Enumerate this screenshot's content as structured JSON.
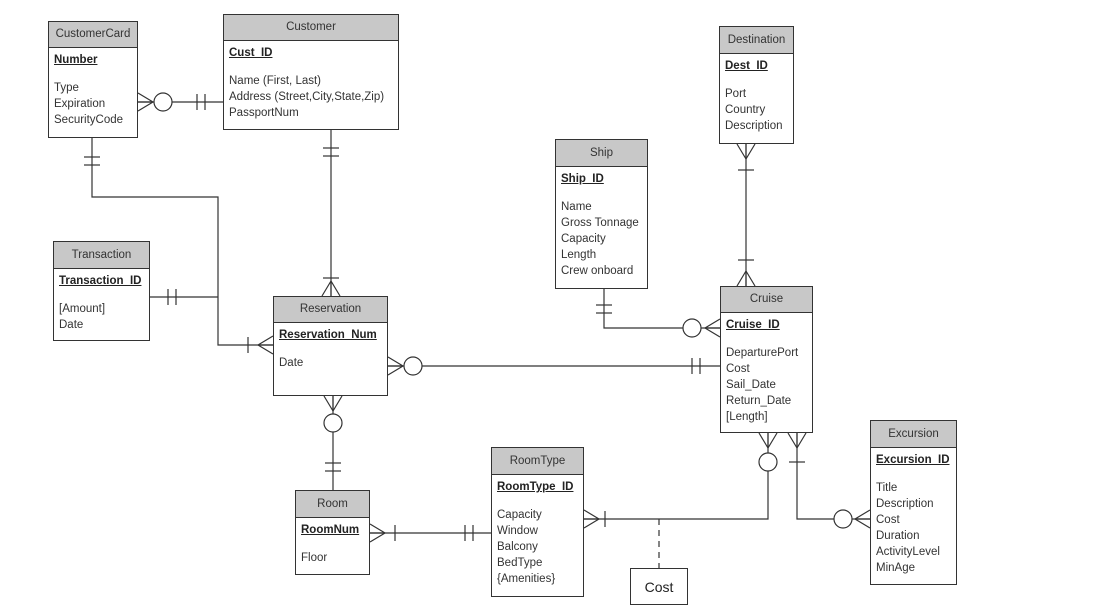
{
  "entities": [
    {
      "name": "CustomerCard",
      "pk": "Number",
      "attrs": [
        "Type",
        "Expiration",
        "SecurityCode"
      ]
    },
    {
      "name": "Customer",
      "pk": "Cust_ID",
      "attrs": [
        "Name (First, Last)",
        "Address (Street,City,State,Zip)",
        "PassportNum"
      ]
    },
    {
      "name": "Transaction",
      "pk": "Transaction_ID",
      "attrs": [
        "[Amount]",
        "Date"
      ]
    },
    {
      "name": "Reservation",
      "pk": "Reservation_Num",
      "attrs": [
        "Date"
      ]
    },
    {
      "name": "Ship",
      "pk": "Ship_ID",
      "attrs": [
        "Name",
        "Gross Tonnage",
        "Capacity",
        "Length",
        "Crew onboard"
      ]
    },
    {
      "name": "Destination",
      "pk": "Dest_ID",
      "attrs": [
        "Port",
        "Country",
        "Description"
      ]
    },
    {
      "name": "Cruise",
      "pk": "Cruise_ID",
      "attrs": [
        "DeparturePort",
        "Cost",
        "Sail_Date",
        "Return_Date",
        "[Length]"
      ]
    },
    {
      "name": "Excursion",
      "pk": "Excursion_ID",
      "attrs": [
        "Title",
        "Description",
        "Cost",
        "Duration",
        "ActivityLevel",
        "MinAge"
      ]
    },
    {
      "name": "Room",
      "pk": "RoomNum",
      "attrs": [
        "Floor"
      ]
    },
    {
      "name": "RoomType",
      "pk": "RoomType_ID",
      "attrs": [
        "Capacity",
        "Window",
        "Balcony",
        "BedType",
        "{Amenities}"
      ]
    }
  ],
  "relationship_attribute": {
    "label": "Cost"
  },
  "relationships": [
    {
      "from": "CustomerCard",
      "to": "Customer",
      "from_card": "zero-or-many",
      "to_card": "one-and-only-one"
    },
    {
      "from": "CustomerCard",
      "to": "Reservation",
      "from_card": "one-and-only-one",
      "to_card": "one-or-many"
    },
    {
      "from": "Transaction",
      "to": "Reservation",
      "from_card": "one-and-only-one",
      "to_card": "one-or-many"
    },
    {
      "from": "Customer",
      "to": "Reservation",
      "from_card": "one-and-only-one",
      "to_card": "one-or-many"
    },
    {
      "from": "Reservation",
      "to": "Cruise",
      "from_card": "zero-or-many",
      "to_card": "one-and-only-one"
    },
    {
      "from": "Ship",
      "to": "Cruise",
      "from_card": "one-and-only-one",
      "to_card": "zero-or-many"
    },
    {
      "from": "Destination",
      "to": "Cruise",
      "from_card": "one-or-many",
      "to_card": "one-or-many"
    },
    {
      "from": "Reservation",
      "to": "Room",
      "from_card": "zero-or-many",
      "to_card": "one-and-only-one"
    },
    {
      "from": "Room",
      "to": "RoomType",
      "from_card": "one-or-many",
      "to_card": "one-and-only-one"
    },
    {
      "from": "RoomType",
      "to": "Cruise",
      "from_card": "one-or-many",
      "to_card": "zero-or-many"
    },
    {
      "from": "Cruise",
      "to": "Excursion",
      "from_card": "one-or-many",
      "to_card": "zero-or-many"
    }
  ]
}
